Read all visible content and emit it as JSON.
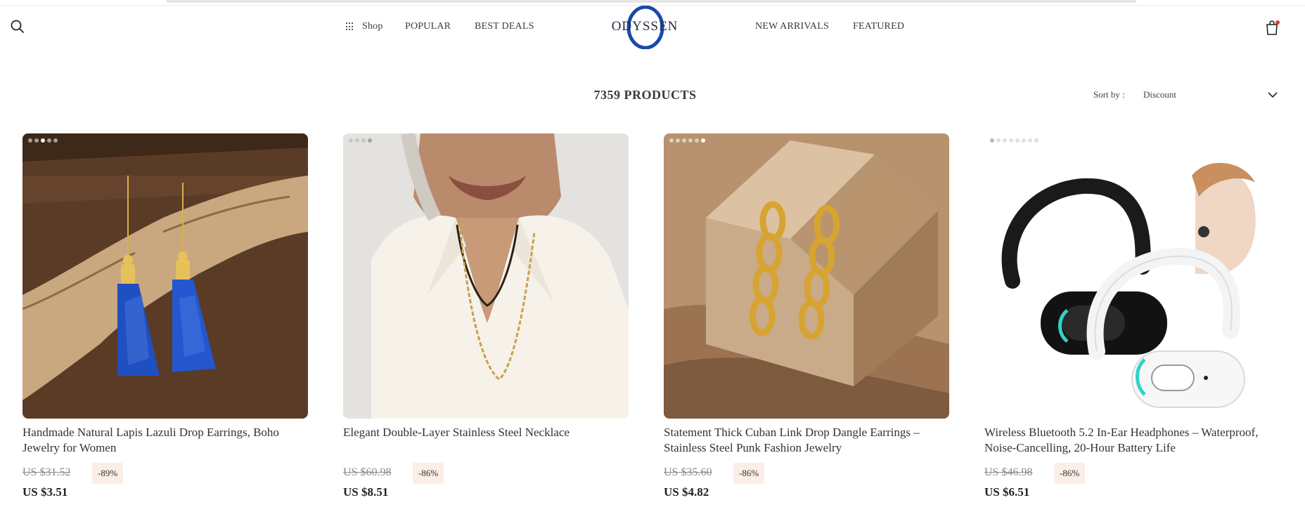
{
  "header": {
    "nav_left": [
      "Shop",
      "POPULAR",
      "BEST DEALS"
    ],
    "nav_right": [
      "NEW ARRIVALS",
      "FEATURED"
    ],
    "logo_text": "ODYSSEN"
  },
  "listing": {
    "count_label": "7359 PRODUCTS",
    "sort_label": "Sort by :",
    "sort_value": "Discount"
  },
  "products": [
    {
      "title": "Handmade Natural Lapis Lazuli Drop Earrings, Boho Jewelry for Women",
      "old_price": "US $31.52",
      "discount": "-89%",
      "price": "US $3.51"
    },
    {
      "title": "Elegant Double-Layer Stainless Steel Necklace",
      "old_price": "US $60.98",
      "discount": "-86%",
      "price": "US $8.51"
    },
    {
      "title": "Statement Thick Cuban Link Drop Dangle Earrings – Stainless Steel Punk Fashion Jewelry",
      "old_price": "US $35.60",
      "discount": "-86%",
      "price": "US $4.82"
    },
    {
      "title": "Wireless Bluetooth 5.2 In-Ear Headphones – Waterproof, Noise-Cancelling, 20-Hour Battery Life",
      "old_price": "US $46.98",
      "discount": "-86%",
      "price": "US $6.51"
    }
  ],
  "colors": {
    "brand": "#1a4aa8",
    "discount_badge_bg": "#fbeee6",
    "cart_dot": "#e53935"
  },
  "icons": [
    "search-icon",
    "grid-icon",
    "shopping-bag-icon",
    "chevron-down-icon"
  ]
}
